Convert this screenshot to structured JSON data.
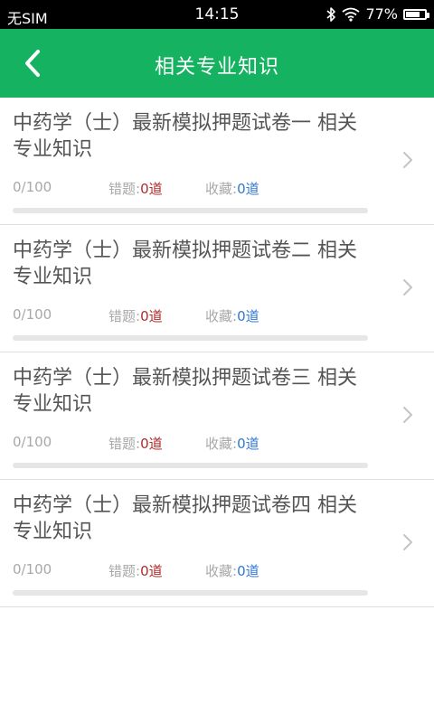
{
  "status_bar": {
    "carrier": "无SIM",
    "time": "14:15",
    "battery_text": "77%",
    "battery_level": 0.77
  },
  "header": {
    "title": "相关专业知识",
    "back_icon": "chevron-left-icon"
  },
  "exams": [
    {
      "title": "中药学（士）最新模拟押题试卷一 相关专业知识",
      "progress": "0/100",
      "progress_value": 0,
      "wrong_label": "错题:",
      "wrong_value": "0道",
      "fav_label": "收藏:",
      "fav_value": "0道"
    },
    {
      "title": "中药学（士）最新模拟押题试卷二 相关专业知识",
      "progress": "0/100",
      "progress_value": 0,
      "wrong_label": "错题:",
      "wrong_value": "0道",
      "fav_label": "收藏:",
      "fav_value": "0道"
    },
    {
      "title": "中药学（士）最新模拟押题试卷三 相关专业知识",
      "progress": "0/100",
      "progress_value": 0,
      "wrong_label": "错题:",
      "wrong_value": "0道",
      "fav_label": "收藏:",
      "fav_value": "0道"
    },
    {
      "title": "中药学（士）最新模拟押题试卷四 相关专业知识",
      "progress": "0/100",
      "progress_value": 0,
      "wrong_label": "错题:",
      "wrong_value": "0道",
      "fav_label": "收藏:",
      "fav_value": "0道"
    }
  ],
  "colors": {
    "header_bg": "#15b262",
    "wrong_value": "#b02a2a",
    "fav_value": "#2f78d6"
  }
}
